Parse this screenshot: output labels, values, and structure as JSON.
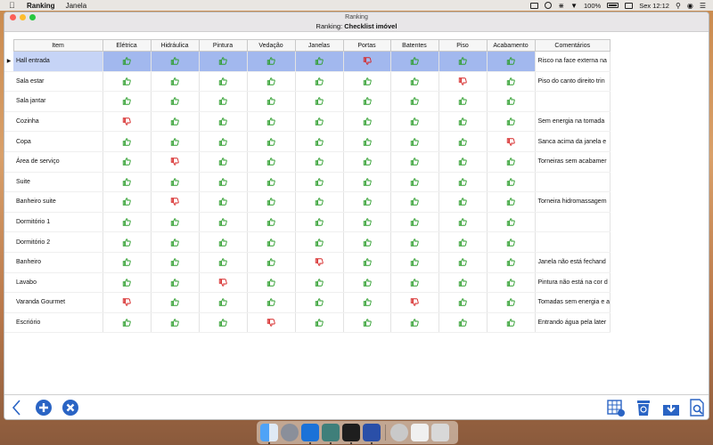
{
  "menubar": {
    "app_name": "Ranking",
    "menu_window": "Janela",
    "battery": "100%",
    "clock": "Sex 12:12"
  },
  "window": {
    "title": "Ranking",
    "subtitle_prefix": "Ranking:",
    "subtitle_name": "Checklist imóvel"
  },
  "table": {
    "columns": [
      "Item",
      "Elétrica",
      "Hidráulica",
      "Pintura",
      "Vedação",
      "Janelas",
      "Portas",
      "Batentes",
      "Piso",
      "Acabamento",
      "Comentários"
    ],
    "rows": [
      {
        "item": "Hall entrada",
        "marks": [
          "up",
          "up",
          "up",
          "up",
          "up",
          "down",
          "up",
          "up",
          "up"
        ],
        "comment": "Risco na face externa na",
        "selected": true
      },
      {
        "item": "Sala estar",
        "marks": [
          "up",
          "up",
          "up",
          "up",
          "up",
          "up",
          "up",
          "down",
          "up"
        ],
        "comment": "Piso do canto direito trin"
      },
      {
        "item": "Sala jantar",
        "marks": [
          "up",
          "up",
          "up",
          "up",
          "up",
          "up",
          "up",
          "up",
          "up"
        ],
        "comment": ""
      },
      {
        "item": "Cozinha",
        "marks": [
          "down",
          "up",
          "up",
          "up",
          "up",
          "up",
          "up",
          "up",
          "up"
        ],
        "comment": "Sem energia na tomada"
      },
      {
        "item": "Copa",
        "marks": [
          "up",
          "up",
          "up",
          "up",
          "up",
          "up",
          "up",
          "up",
          "down"
        ],
        "comment": "Sanca acima da janela e"
      },
      {
        "item": "Área de serviço",
        "marks": [
          "up",
          "down",
          "up",
          "up",
          "up",
          "up",
          "up",
          "up",
          "up"
        ],
        "comment": "Torneiras sem acabamer"
      },
      {
        "item": "Suite",
        "marks": [
          "up",
          "up",
          "up",
          "up",
          "up",
          "up",
          "up",
          "up",
          "up"
        ],
        "comment": ""
      },
      {
        "item": "Banheiro suite",
        "marks": [
          "up",
          "down",
          "up",
          "up",
          "up",
          "up",
          "up",
          "up",
          "up"
        ],
        "comment": "Torneira hidromassagem"
      },
      {
        "item": "Dormitório 1",
        "marks": [
          "up",
          "up",
          "up",
          "up",
          "up",
          "up",
          "up",
          "up",
          "up"
        ],
        "comment": ""
      },
      {
        "item": "Dormitório 2",
        "marks": [
          "up",
          "up",
          "up",
          "up",
          "up",
          "up",
          "up",
          "up",
          "up"
        ],
        "comment": ""
      },
      {
        "item": "Banheiro",
        "marks": [
          "up",
          "up",
          "up",
          "up",
          "down",
          "up",
          "up",
          "up",
          "up"
        ],
        "comment": "Janela não está fechand"
      },
      {
        "item": "Lavabo",
        "marks": [
          "up",
          "up",
          "down",
          "up",
          "up",
          "up",
          "up",
          "up",
          "up"
        ],
        "comment": "Pintura não está na cor d"
      },
      {
        "item": "Varanda Gourmet",
        "marks": [
          "down",
          "up",
          "up",
          "up",
          "up",
          "up",
          "down",
          "up",
          "up"
        ],
        "comment": "Tomadas sem energia e a"
      },
      {
        "item": "Escriório",
        "marks": [
          "up",
          "up",
          "up",
          "down",
          "up",
          "up",
          "up",
          "up",
          "up"
        ],
        "comment": "Entrando água pela later"
      }
    ]
  },
  "toolbar": {
    "left": [
      "back-icon",
      "add-icon",
      "delete-icon"
    ],
    "right": [
      "edit-grid-icon",
      "recycle-trash-icon",
      "download-icon",
      "search-document-icon"
    ]
  },
  "dock": [
    "finder-icon",
    "launchpad-icon",
    "teamviewer-icon",
    "app-icon",
    "terminal-icon",
    "ranking-app-icon",
    "preferences-icon",
    "documents-icon",
    "trash-icon"
  ],
  "colors": {
    "thumb_up": "#2e9e2e",
    "thumb_down": "#d62626",
    "selection": "#a2b8ee"
  }
}
